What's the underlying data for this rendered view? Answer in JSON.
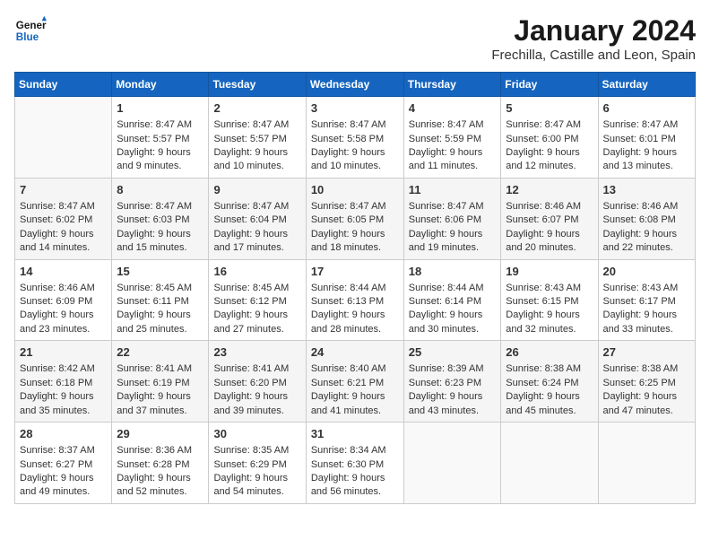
{
  "header": {
    "logo_general": "General",
    "logo_blue": "Blue",
    "title": "January 2024",
    "subtitle": "Frechilla, Castille and Leon, Spain"
  },
  "days_of_week": [
    "Sunday",
    "Monday",
    "Tuesday",
    "Wednesday",
    "Thursday",
    "Friday",
    "Saturday"
  ],
  "weeks": [
    [
      {
        "day": "",
        "empty": true
      },
      {
        "day": "1",
        "sunrise": "Sunrise: 8:47 AM",
        "sunset": "Sunset: 5:57 PM",
        "daylight": "Daylight: 9 hours and 9 minutes."
      },
      {
        "day": "2",
        "sunrise": "Sunrise: 8:47 AM",
        "sunset": "Sunset: 5:57 PM",
        "daylight": "Daylight: 9 hours and 10 minutes."
      },
      {
        "day": "3",
        "sunrise": "Sunrise: 8:47 AM",
        "sunset": "Sunset: 5:58 PM",
        "daylight": "Daylight: 9 hours and 10 minutes."
      },
      {
        "day": "4",
        "sunrise": "Sunrise: 8:47 AM",
        "sunset": "Sunset: 5:59 PM",
        "daylight": "Daylight: 9 hours and 11 minutes."
      },
      {
        "day": "5",
        "sunrise": "Sunrise: 8:47 AM",
        "sunset": "Sunset: 6:00 PM",
        "daylight": "Daylight: 9 hours and 12 minutes."
      },
      {
        "day": "6",
        "sunrise": "Sunrise: 8:47 AM",
        "sunset": "Sunset: 6:01 PM",
        "daylight": "Daylight: 9 hours and 13 minutes."
      }
    ],
    [
      {
        "day": "7",
        "sunrise": "Sunrise: 8:47 AM",
        "sunset": "Sunset: 6:02 PM",
        "daylight": "Daylight: 9 hours and 14 minutes."
      },
      {
        "day": "8",
        "sunrise": "Sunrise: 8:47 AM",
        "sunset": "Sunset: 6:03 PM",
        "daylight": "Daylight: 9 hours and 15 minutes."
      },
      {
        "day": "9",
        "sunrise": "Sunrise: 8:47 AM",
        "sunset": "Sunset: 6:04 PM",
        "daylight": "Daylight: 9 hours and 17 minutes."
      },
      {
        "day": "10",
        "sunrise": "Sunrise: 8:47 AM",
        "sunset": "Sunset: 6:05 PM",
        "daylight": "Daylight: 9 hours and 18 minutes."
      },
      {
        "day": "11",
        "sunrise": "Sunrise: 8:47 AM",
        "sunset": "Sunset: 6:06 PM",
        "daylight": "Daylight: 9 hours and 19 minutes."
      },
      {
        "day": "12",
        "sunrise": "Sunrise: 8:46 AM",
        "sunset": "Sunset: 6:07 PM",
        "daylight": "Daylight: 9 hours and 20 minutes."
      },
      {
        "day": "13",
        "sunrise": "Sunrise: 8:46 AM",
        "sunset": "Sunset: 6:08 PM",
        "daylight": "Daylight: 9 hours and 22 minutes."
      }
    ],
    [
      {
        "day": "14",
        "sunrise": "Sunrise: 8:46 AM",
        "sunset": "Sunset: 6:09 PM",
        "daylight": "Daylight: 9 hours and 23 minutes."
      },
      {
        "day": "15",
        "sunrise": "Sunrise: 8:45 AM",
        "sunset": "Sunset: 6:11 PM",
        "daylight": "Daylight: 9 hours and 25 minutes."
      },
      {
        "day": "16",
        "sunrise": "Sunrise: 8:45 AM",
        "sunset": "Sunset: 6:12 PM",
        "daylight": "Daylight: 9 hours and 27 minutes."
      },
      {
        "day": "17",
        "sunrise": "Sunrise: 8:44 AM",
        "sunset": "Sunset: 6:13 PM",
        "daylight": "Daylight: 9 hours and 28 minutes."
      },
      {
        "day": "18",
        "sunrise": "Sunrise: 8:44 AM",
        "sunset": "Sunset: 6:14 PM",
        "daylight": "Daylight: 9 hours and 30 minutes."
      },
      {
        "day": "19",
        "sunrise": "Sunrise: 8:43 AM",
        "sunset": "Sunset: 6:15 PM",
        "daylight": "Daylight: 9 hours and 32 minutes."
      },
      {
        "day": "20",
        "sunrise": "Sunrise: 8:43 AM",
        "sunset": "Sunset: 6:17 PM",
        "daylight": "Daylight: 9 hours and 33 minutes."
      }
    ],
    [
      {
        "day": "21",
        "sunrise": "Sunrise: 8:42 AM",
        "sunset": "Sunset: 6:18 PM",
        "daylight": "Daylight: 9 hours and 35 minutes."
      },
      {
        "day": "22",
        "sunrise": "Sunrise: 8:41 AM",
        "sunset": "Sunset: 6:19 PM",
        "daylight": "Daylight: 9 hours and 37 minutes."
      },
      {
        "day": "23",
        "sunrise": "Sunrise: 8:41 AM",
        "sunset": "Sunset: 6:20 PM",
        "daylight": "Daylight: 9 hours and 39 minutes."
      },
      {
        "day": "24",
        "sunrise": "Sunrise: 8:40 AM",
        "sunset": "Sunset: 6:21 PM",
        "daylight": "Daylight: 9 hours and 41 minutes."
      },
      {
        "day": "25",
        "sunrise": "Sunrise: 8:39 AM",
        "sunset": "Sunset: 6:23 PM",
        "daylight": "Daylight: 9 hours and 43 minutes."
      },
      {
        "day": "26",
        "sunrise": "Sunrise: 8:38 AM",
        "sunset": "Sunset: 6:24 PM",
        "daylight": "Daylight: 9 hours and 45 minutes."
      },
      {
        "day": "27",
        "sunrise": "Sunrise: 8:38 AM",
        "sunset": "Sunset: 6:25 PM",
        "daylight": "Daylight: 9 hours and 47 minutes."
      }
    ],
    [
      {
        "day": "28",
        "sunrise": "Sunrise: 8:37 AM",
        "sunset": "Sunset: 6:27 PM",
        "daylight": "Daylight: 9 hours and 49 minutes."
      },
      {
        "day": "29",
        "sunrise": "Sunrise: 8:36 AM",
        "sunset": "Sunset: 6:28 PM",
        "daylight": "Daylight: 9 hours and 52 minutes."
      },
      {
        "day": "30",
        "sunrise": "Sunrise: 8:35 AM",
        "sunset": "Sunset: 6:29 PM",
        "daylight": "Daylight: 9 hours and 54 minutes."
      },
      {
        "day": "31",
        "sunrise": "Sunrise: 8:34 AM",
        "sunset": "Sunset: 6:30 PM",
        "daylight": "Daylight: 9 hours and 56 minutes."
      },
      {
        "day": "",
        "empty": true
      },
      {
        "day": "",
        "empty": true
      },
      {
        "day": "",
        "empty": true
      }
    ]
  ]
}
